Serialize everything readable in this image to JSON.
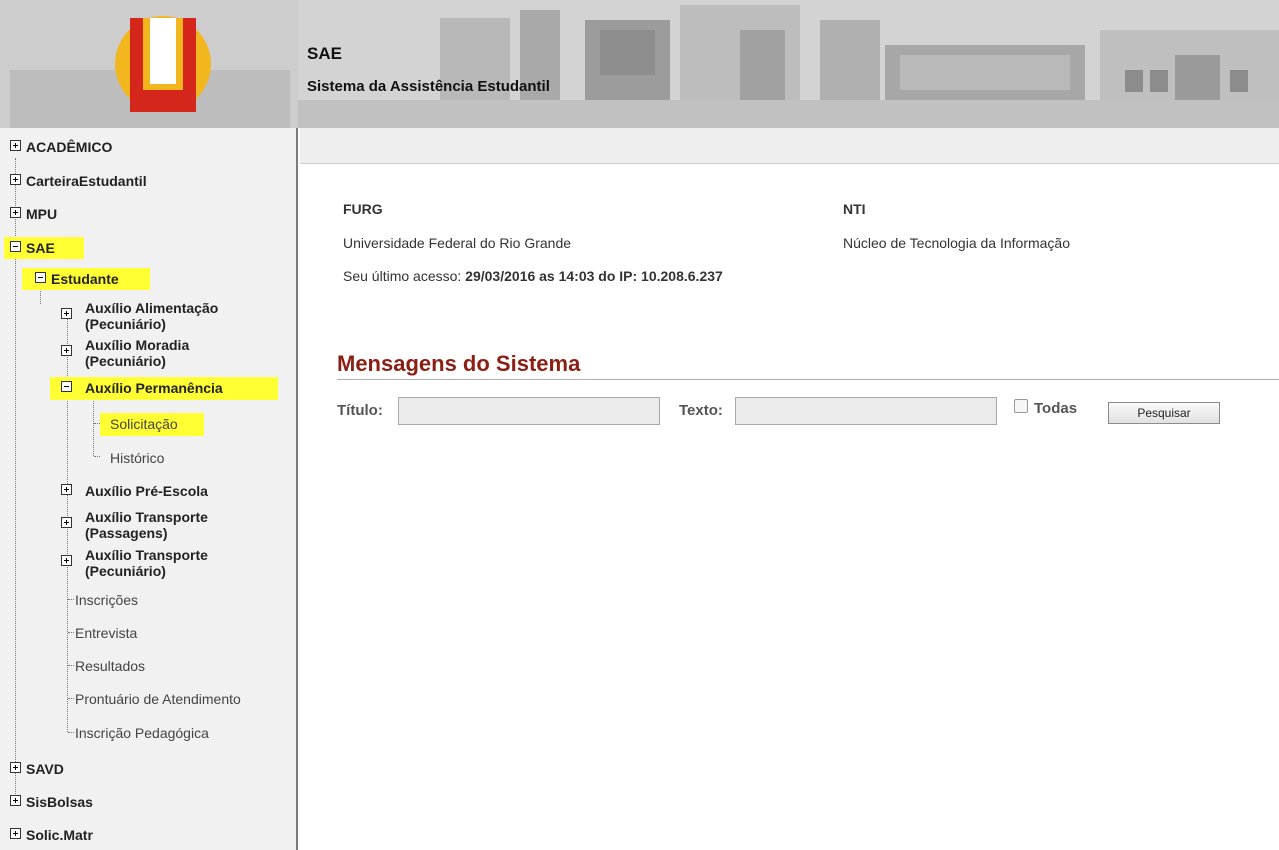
{
  "header": {
    "title": "SAE",
    "subtitle": "Sistema da Assistência Estudantil"
  },
  "colors": {
    "highlight": "#ffff33",
    "message_title": "#8b1f14",
    "logo_red": "#d5261b",
    "logo_yellow": "#f2b71f"
  },
  "sidebar": {
    "academico": "ACADÊMICO",
    "carteira": "CarteiraEstudantil",
    "mpu": "MPU",
    "sae": "SAE",
    "estudante": "Estudante",
    "alimentacao_1": "Auxílio Alimentação",
    "alimentacao_2": "(Pecuniário)",
    "moradia_1": "Auxílio Moradia",
    "moradia_2": "(Pecuniário)",
    "permanencia": "Auxílio Permanência",
    "solicitacao": "Solicitação",
    "historico": "Histórico",
    "pre_escola": "Auxílio Pré-Escola",
    "transporte_pass_1": "Auxílio Transporte",
    "transporte_pass_2": "(Passagens)",
    "transporte_pec_1": "Auxílio Transporte",
    "transporte_pec_2": "(Pecuniário)",
    "inscricoes": "Inscrições",
    "entrevista": "Entrevista",
    "resultados": "Resultados",
    "prontuario": "Prontuário de Atendimento",
    "inscricao_pedagogica": "Inscrição Pedagógica",
    "savd": "SAVD",
    "sisbolsas": "SisBolsas",
    "solic_matr": "Solic.Matr"
  },
  "info": {
    "org_code": "FURG",
    "org_name": "Universidade Federal do Rio Grande",
    "unit_code": "NTI",
    "unit_name": "Núcleo de Tecnologia da Informação",
    "last_access_prefix": "Seu último acesso: ",
    "last_access_value": "29/03/2016 as 14:03 do IP: 10.208.6.237"
  },
  "messages": {
    "title": "Mensagens do Sistema",
    "titulo_label": "Título:",
    "titulo_value": "",
    "texto_label": "Texto:",
    "texto_value": "",
    "todas_label": "Todas",
    "search_button": "Pesquisar"
  }
}
